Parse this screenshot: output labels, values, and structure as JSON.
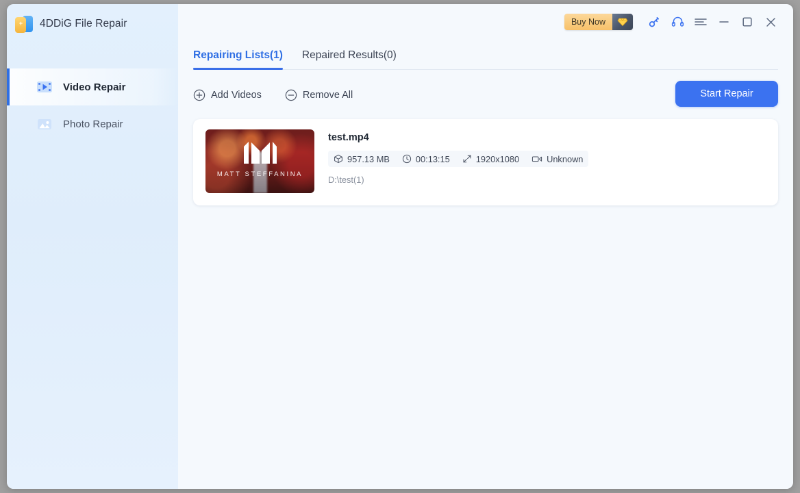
{
  "app": {
    "title": "4DDiG File Repair",
    "logo_icon": "4ddig-logo-icon"
  },
  "titlebar": {
    "buy_now_label": "Buy Now",
    "gem_icon": "diamond-gem-icon",
    "key_icon": "key-icon",
    "support_icon": "headset-icon",
    "menu_icon": "hamburger-menu-icon",
    "minimize_icon": "minimize-icon",
    "maximize_icon": "maximize-icon",
    "close_icon": "close-icon"
  },
  "sidebar": {
    "items": [
      {
        "label": "Video Repair",
        "icon": "video-film-play-icon",
        "active": true
      },
      {
        "label": "Photo Repair",
        "icon": "photo-image-icon",
        "active": false
      }
    ]
  },
  "tabs": [
    {
      "label": "Repairing Lists(1)",
      "active": true
    },
    {
      "label": "Repaired Results(0)",
      "active": false
    }
  ],
  "toolbar": {
    "add_videos_label": "Add Videos",
    "add_videos_icon": "plus-circle-icon",
    "remove_all_label": "Remove All",
    "remove_all_icon": "minus-circle-icon",
    "start_repair_label": "Start Repair"
  },
  "files": [
    {
      "name": "test.mp4",
      "size": "957.13 MB",
      "duration": "00:13:15",
      "resolution": "1920x1080",
      "codec": "Unknown",
      "path": "D:\\test(1)",
      "thumbnail_text": "MATT STEFFANINA",
      "size_icon": "cube-icon",
      "duration_icon": "clock-icon",
      "resolution_icon": "resize-arrows-icon",
      "codec_icon": "video-camera-icon"
    }
  ],
  "colors": {
    "accent": "#3b72f0",
    "tab_active": "#2f6fe4",
    "sidebar_bg": "#e3f0fd",
    "main_bg": "#f5f9fd",
    "card_bg": "#ffffff",
    "buy_now_bg": "#f7c169"
  }
}
